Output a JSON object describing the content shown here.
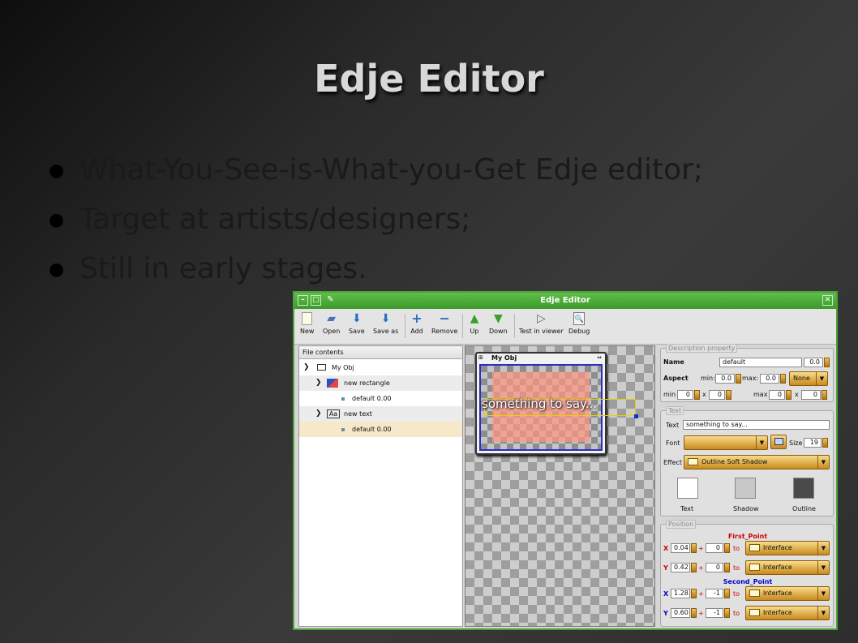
{
  "slide": {
    "title": "Edje Editor",
    "bullets": [
      "What-You-See-is-What-you-Get Edje editor;",
      "Target at artists/designers;",
      "Still in early stages."
    ]
  },
  "window": {
    "title": "Edje Editor",
    "toolbar": [
      "New",
      "Open",
      "Save",
      "Save as",
      "Add",
      "Remove",
      "Up",
      "Down",
      "Test in viewer",
      "Debug"
    ],
    "file_panel": {
      "header": "File contents",
      "tree": [
        {
          "label": "My Obj",
          "icon": "group-icon"
        },
        {
          "label": "new rectangle",
          "icon": "rectangle-icon"
        },
        {
          "label": "default 0.00",
          "icon": "state-icon"
        },
        {
          "label": "new text",
          "icon": "text-icon",
          "icon_text": "Aa"
        },
        {
          "label": "default 0.00",
          "icon": "state-icon",
          "selected": true
        }
      ]
    },
    "canvas": {
      "group_title": "My Obj",
      "text": "something to say..."
    },
    "description": {
      "title": "Description property",
      "name_label": "Name",
      "name_value": "default",
      "state_value": "0.0",
      "aspect_label": "Aspect",
      "min_label": "min:",
      "min_value": "0.0",
      "max_label": "max:",
      "max_value": "0.0",
      "aspect_pref": "None",
      "size_min_label": "min",
      "size_min_x": "0",
      "size_min_y": "0",
      "size_max_label": "max",
      "size_max_x": "0",
      "size_max_y": "0",
      "x_sep": "x"
    },
    "text": {
      "title": "Text",
      "text_label": "Text",
      "text_value": "something to say...",
      "font_label": "Font",
      "font_value": "",
      "size_label": "Size",
      "size_value": "19",
      "effect_label": "Effect",
      "effect_value": "Outline Soft Shadow",
      "swatches": [
        {
          "label": "Text",
          "color": "#ffffff"
        },
        {
          "label": "Shadow",
          "color": "#c8c8c8"
        },
        {
          "label": "Outline",
          "color": "#4a4a4a"
        }
      ]
    },
    "position": {
      "title": "Position",
      "first_point": "First_Point",
      "second_point": "Second_Point",
      "rows": [
        {
          "axis": "X",
          "rel": "0.04",
          "offset": "0",
          "to": "Interface"
        },
        {
          "axis": "Y",
          "rel": "0.42",
          "offset": "0",
          "to": "Interface"
        },
        {
          "axis": "X",
          "rel": "1.28",
          "offset": "-1",
          "to": "Interface"
        },
        {
          "axis": "Y",
          "rel": "0.60",
          "offset": "-1",
          "to": "Interface"
        }
      ],
      "plus": "+",
      "to_label": "to"
    }
  }
}
